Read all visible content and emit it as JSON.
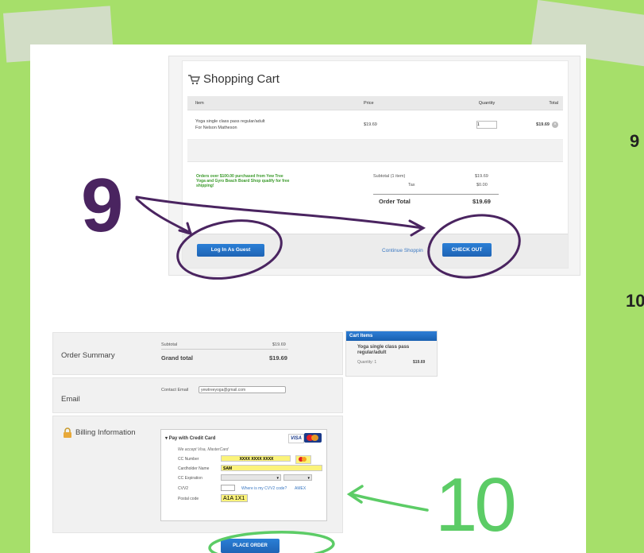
{
  "step_numbers": {
    "nine": "9",
    "ten": "10"
  },
  "edge_numbers": {
    "first": "9",
    "second": "10"
  },
  "cart": {
    "title": "Shopping Cart",
    "columns": {
      "item": "Item",
      "price": "Price",
      "quantity": "Quantity",
      "total": "Total"
    },
    "row": {
      "item_name": "Yoga single class pass regular/adult",
      "item_for": "For Nelson Matheson",
      "price": "$19.69",
      "quantity": "1",
      "total": "$19.69"
    },
    "promo": "Orders over $100.00 purchased from Yew Tree Yoga and Gyro Beach Board Shop qualify for free shipping!",
    "subtotal_label": "Subtotal (1 item)",
    "subtotal_value": "$19.69",
    "tax_label": "Tax",
    "tax_value": "$0.00",
    "order_total_label": "Order Total",
    "order_total_value": "$19.69",
    "guest_button": "Log In As Guest",
    "continue_link": "Continue Shoppin",
    "checkout_button": "CHECK OUT"
  },
  "checkout": {
    "order_summary": {
      "title": "Order Summary",
      "subtotal_label": "Subtotal",
      "subtotal_value": "$19.69",
      "grand_total_label": "Grand total",
      "grand_total_value": "$19.69"
    },
    "email": {
      "title": "Email",
      "contact_label": "Contact Email",
      "contact_value": "yewtreeyoga@gmail.com"
    },
    "billing": {
      "title": "Billing Information",
      "pay_with": "Pay with Credit Card",
      "accept_note": "We accept Visa, MasterCard",
      "visa_label": "VISA",
      "cc_number_label": "CC Number",
      "cc_number_value": "XXXX XXXX XXXX",
      "cardholder_label": "Cardholder Name",
      "cardholder_value": "SAM",
      "expiration_label": "CC Expiration",
      "cvv_label": "CVV2",
      "cvv_link": "Where is my CVV2 code?",
      "amex_label": "AMEX",
      "postal_label": "Postal code",
      "postal_value": "A1A 1X1"
    },
    "place_order_button": "PLACE ORDER",
    "cart_items": {
      "header": "Cart Items",
      "item_name": "Yoga single class pass regular/adult",
      "quantity": "Quantity: 1",
      "price": "$19.69"
    }
  },
  "colors": {
    "background": "#a6df6a",
    "annotation_purple": "#4a2460",
    "annotation_green": "#5ccc66",
    "button_blue": "#1f64b5"
  }
}
